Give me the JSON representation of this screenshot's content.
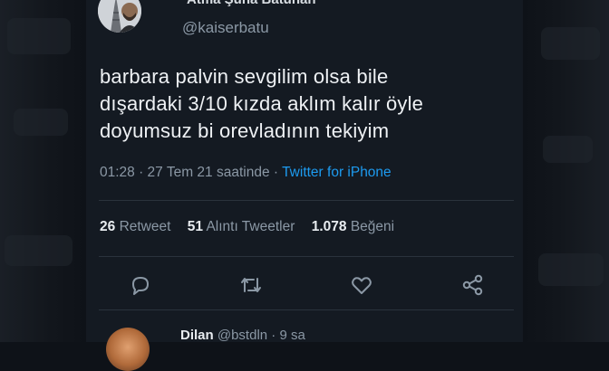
{
  "tweet": {
    "author_name": "Atma Şuna Batuhan",
    "handle": "@kaiserbatu",
    "text_lines": [
      "barbara palvin sevgilim olsa bile",
      "dışardaki 3/10 kızda aklım kalır öyle",
      "doyumsuz bi orevladının tekiyim"
    ],
    "timestamp": "01:28 · 27 Tem 21 saatinde · ",
    "client": "Twitter for iPhone",
    "stats": {
      "retweets_count": "26",
      "retweets_label": "Retweet",
      "quotes_count": "51",
      "quotes_label": "Alıntı Tweetler",
      "likes_count": "1.078",
      "likes_label": "Beğeni"
    },
    "actions": [
      "reply-icon",
      "retweet-icon",
      "like-icon",
      "share-icon"
    ]
  },
  "reply": {
    "name": "Dilan",
    "handle": "@bstdln · 9 sa"
  },
  "colors": {
    "background": "#141a22",
    "link": "#1d9bf0",
    "muted": "#8b98a5",
    "text": "#eef1f4"
  }
}
